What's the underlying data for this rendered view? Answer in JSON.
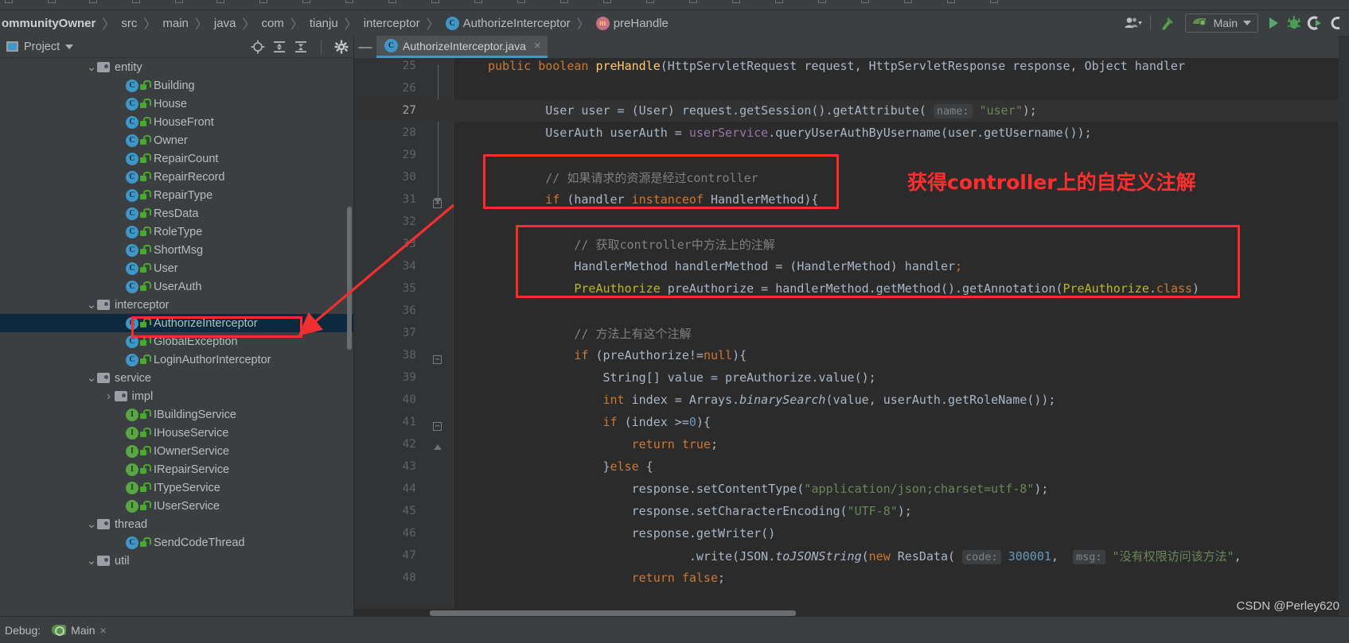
{
  "breadcrumb": {
    "items": [
      {
        "label": "ommunityOwner",
        "icon": "none",
        "first": true
      },
      {
        "label": "src",
        "icon": "none"
      },
      {
        "label": "main",
        "icon": "none"
      },
      {
        "label": "java",
        "icon": "none"
      },
      {
        "label": "com",
        "icon": "none"
      },
      {
        "label": "tianju",
        "icon": "none"
      },
      {
        "label": "interceptor",
        "icon": "none"
      },
      {
        "label": "AuthorizeInterceptor",
        "icon": "class-icon"
      },
      {
        "label": "preHandle",
        "icon": "method-icon"
      }
    ]
  },
  "toolbar": {
    "user_icon": "user-avatar-icon",
    "build_icon": "build-hammer-icon",
    "run_config": "Main",
    "run_config_icon": "run-config-icon",
    "run_icon": "run-button",
    "debug_icon": "debug-button",
    "coverage_icon": "run-with-coverage-button",
    "extra_icon": "more-actions-button"
  },
  "project_panel": {
    "title": "Project",
    "actions": [
      "locate-icon",
      "expand-all-icon",
      "collapse-all-icon",
      "settings-gear-icon"
    ],
    "tree": [
      {
        "label": "entity",
        "type": "folder",
        "indent": 3,
        "chevron": "down"
      },
      {
        "label": "Building",
        "type": "class",
        "indent": 4
      },
      {
        "label": "House",
        "type": "class",
        "indent": 4
      },
      {
        "label": "HouseFront",
        "type": "class",
        "indent": 4
      },
      {
        "label": "Owner",
        "type": "class",
        "indent": 4
      },
      {
        "label": "RepairCount",
        "type": "class",
        "indent": 4
      },
      {
        "label": "RepairRecord",
        "type": "class",
        "indent": 4
      },
      {
        "label": "RepairType",
        "type": "class",
        "indent": 4
      },
      {
        "label": "ResData",
        "type": "class",
        "indent": 4
      },
      {
        "label": "RoleType",
        "type": "class",
        "indent": 4
      },
      {
        "label": "ShortMsg",
        "type": "class",
        "indent": 4
      },
      {
        "label": "User",
        "type": "class",
        "indent": 4
      },
      {
        "label": "UserAuth",
        "type": "class",
        "indent": 4
      },
      {
        "label": "interceptor",
        "type": "folder",
        "indent": 3,
        "chevron": "down"
      },
      {
        "label": "AuthorizeInterceptor",
        "type": "class",
        "indent": 4,
        "selected": true,
        "annotated": true
      },
      {
        "label": "GlobalException",
        "type": "class",
        "indent": 4
      },
      {
        "label": "LoginAuthorInterceptor",
        "type": "class",
        "indent": 4
      },
      {
        "label": "service",
        "type": "folder",
        "indent": 3,
        "chevron": "down"
      },
      {
        "label": "impl",
        "type": "folder",
        "indent": 3.6,
        "chevron": "right"
      },
      {
        "label": "IBuildingService",
        "type": "interface",
        "indent": 4
      },
      {
        "label": "IHouseService",
        "type": "interface",
        "indent": 4
      },
      {
        "label": "IOwnerService",
        "type": "interface",
        "indent": 4
      },
      {
        "label": "IRepairService",
        "type": "interface",
        "indent": 4
      },
      {
        "label": "ITypeService",
        "type": "interface",
        "indent": 4
      },
      {
        "label": "IUserService",
        "type": "interface",
        "indent": 4
      },
      {
        "label": "thread",
        "type": "folder",
        "indent": 3,
        "chevron": "down"
      },
      {
        "label": "SendCodeThread",
        "type": "class",
        "indent": 4
      },
      {
        "label": "util",
        "type": "folder",
        "indent": 3,
        "chevron": "down"
      }
    ]
  },
  "editor": {
    "tab": {
      "label": "AuthorizeInterceptor.java",
      "icon": "class-icon",
      "close": "×"
    },
    "minimize": "—",
    "lines": [
      {
        "num": "25",
        "html": "<span class=\"kw\">public</span> <span class=\"kw\">boolean</span> <span class=\"mth\">preHandle</span>(HttpServletRequest request, HttpServletResponse response, Object handler"
      },
      {
        "num": "26",
        "html": ""
      },
      {
        "num": "27",
        "html": "        User user = (User) request.getSession().getAttribute( <span class=\"hint\">name:</span> <span class=\"str\">\"user\"</span>);",
        "current": true
      },
      {
        "num": "28",
        "html": "        UserAuth userAuth = <span class=\"fld\">userService</span>.queryUserAuthByUsername(user.getUsername());"
      },
      {
        "num": "29",
        "html": ""
      },
      {
        "num": "30",
        "html": "        <span class=\"cmt\">// 如果请求的资源是经过controller</span>"
      },
      {
        "num": "31",
        "html": "        <span class=\"kw\">if</span> (handler <span class=\"kw\">instanceof</span> HandlerMethod){"
      },
      {
        "num": "32",
        "html": ""
      },
      {
        "num": "33",
        "html": "            <span class=\"cmt\">// 获取controller中方法上的注解</span>"
      },
      {
        "num": "34",
        "html": "            HandlerMethod handlerMethod = (HandlerMethod) handler<span class=\"kw\">;</span>"
      },
      {
        "num": "35",
        "html": "            <span class=\"ann\">PreAuthorize</span> preAuthorize = handlerMethod.getMethod().getAnnotation(<span class=\"ann\">PreAuthorize</span>.<span class=\"kw\">class</span>)"
      },
      {
        "num": "36",
        "html": ""
      },
      {
        "num": "37",
        "html": "            <span class=\"cmt\">// 方法上有这个注解</span>"
      },
      {
        "num": "38",
        "html": "            <span class=\"kw\">if</span> (preAuthorize!=<span class=\"kw\">null</span>){"
      },
      {
        "num": "39",
        "html": "                String[] value = preAuthorize.value();"
      },
      {
        "num": "40",
        "html": "                <span class=\"kw\">int</span> index = Arrays.<span class=\"ital\">binarySearch</span>(value, userAuth.getRoleName());"
      },
      {
        "num": "41",
        "html": "                <span class=\"kw\">if</span> (index &gt;=<span class=\"num\">0</span>){"
      },
      {
        "num": "42",
        "html": "                    <span class=\"kw\">return</span> <span class=\"kw\">true</span>;"
      },
      {
        "num": "43",
        "html": "                }<span class=\"kw\">else</span> {"
      },
      {
        "num": "44",
        "html": "                    response.setContentType(<span class=\"str\">\"application/json;charset=utf-8\"</span>);"
      },
      {
        "num": "45",
        "html": "                    response.setCharacterEncoding(<span class=\"str\">\"UTF-8\"</span>);"
      },
      {
        "num": "46",
        "html": "                    response.getWriter()"
      },
      {
        "num": "47",
        "html": "                            .write(JSON.<span class=\"ital\">toJSONString</span>(<span class=\"kw\">new</span> ResData( <span class=\"hint\">code:</span> <span class=\"num\">300001</span>,  <span class=\"hint\">msg:</span> <span class=\"str\">\"没有权限访问该方法\"</span>,"
      },
      {
        "num": "48",
        "html": "                    <span class=\"kw\">return</span> <span class=\"kw\">false</span>;"
      }
    ]
  },
  "annotations": {
    "red_text": "获得controller上的自定义注解",
    "red_color": "#ff2d2d",
    "box_controller_check": "if (handler instanceof HandlerMethod)",
    "box_get_annotation": "HandlerMethod / PreAuthorize block",
    "box_tree_file": "AuthorizeInterceptor",
    "arrow": "arrow-from-tree-to-code"
  },
  "statusbar": {
    "debug_label": "Debug:",
    "run_tab": "Main",
    "run_tab_icon": "run-config-icon",
    "close": "×"
  },
  "watermark": "CSDN @Perley620",
  "colors": {
    "panel_bg": "#3c3f41",
    "editor_bg": "#2b2b2b",
    "gutter_bg": "#313335",
    "accent": "#3e97c8",
    "selection": "#0d293e",
    "annotation_red": "#ff2b2b",
    "text": "#bbbbbb",
    "code_text": "#a9b7c6"
  }
}
